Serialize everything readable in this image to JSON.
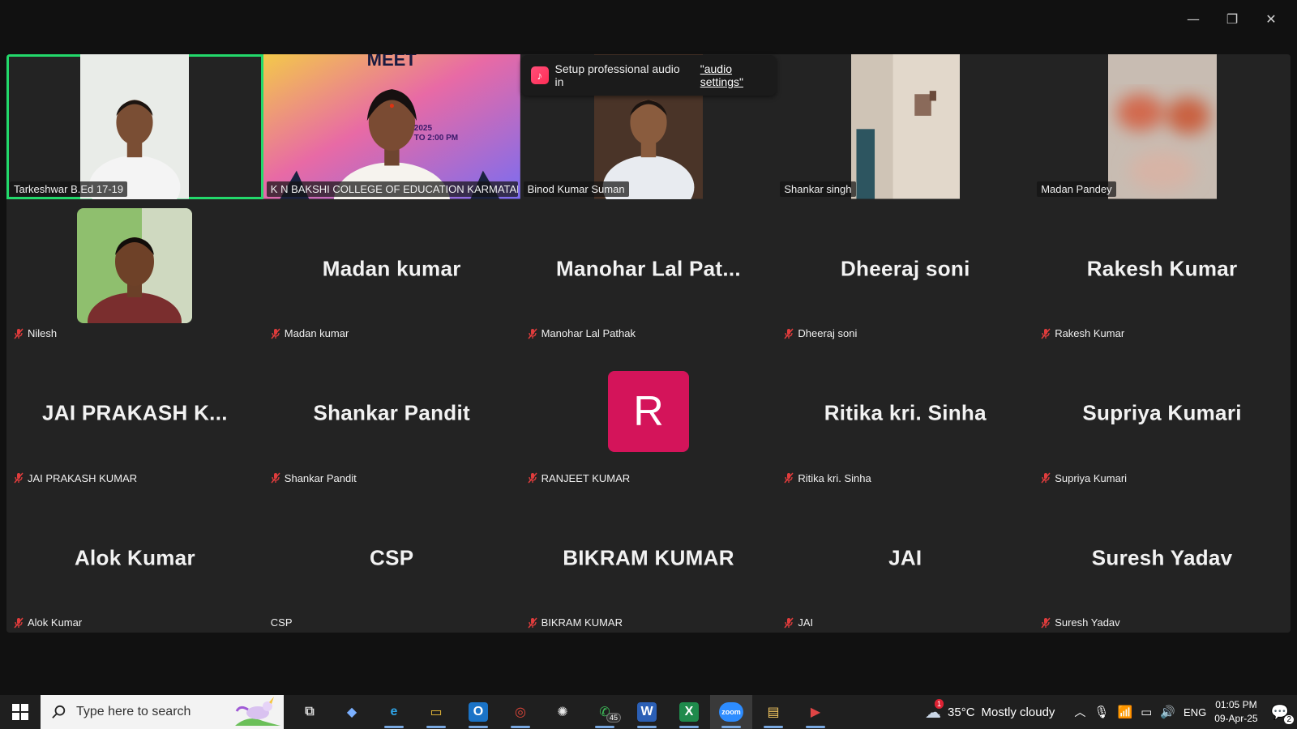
{
  "window": {
    "controls": [
      "—",
      "❐",
      "✕"
    ]
  },
  "toast": {
    "text": "Setup professional audio in",
    "link": "\"audio settings\""
  },
  "tiles": [
    {
      "kind": "video",
      "plate": "Tarkeshwar B.Ed 17-19",
      "muted": false,
      "active": true
    },
    {
      "kind": "video-wide",
      "plate": "K N BAKSHI COLLEGE OF EDUCATION KARMATAND...",
      "muted": false,
      "banner": "MEET",
      "banner_time": "2025",
      "banner_time2": "TO 2:00 PM"
    },
    {
      "kind": "video",
      "plate": "Binod Kumar Suman",
      "muted": false
    },
    {
      "kind": "video",
      "plate": "Shankar singh",
      "muted": false
    },
    {
      "kind": "video",
      "plate": "Madan Pandey",
      "muted": false
    },
    {
      "kind": "photo",
      "plate": "Nilesh",
      "muted": true
    },
    {
      "kind": "name",
      "big": "Madan kumar",
      "plate": "Madan kumar",
      "muted": true
    },
    {
      "kind": "name",
      "big": "Manohar  Lal  Pat...",
      "plate": "Manohar Lal Pathak",
      "muted": true
    },
    {
      "kind": "name",
      "big": "Dheeraj soni",
      "plate": "Dheeraj soni",
      "muted": true
    },
    {
      "kind": "name",
      "big": "Rakesh Kumar",
      "plate": "Rakesh Kumar",
      "muted": true
    },
    {
      "kind": "name",
      "big": "JAI  PRAKASH  K...",
      "plate": "JAI PRAKASH KUMAR",
      "muted": true
    },
    {
      "kind": "name",
      "big": "Shankar Pandit",
      "plate": "Shankar Pandit",
      "muted": true
    },
    {
      "kind": "letter",
      "letter": "R",
      "plate": "RANJEET KUMAR",
      "muted": true
    },
    {
      "kind": "name",
      "big": "Ritika kri. Sinha",
      "plate": "Ritika kri. Sinha",
      "muted": true
    },
    {
      "kind": "name",
      "big": "Supriya Kumari",
      "plate": "Supriya Kumari",
      "muted": true
    },
    {
      "kind": "name",
      "big": "Alok Kumar",
      "plate": "Alok Kumar",
      "muted": true
    },
    {
      "kind": "name",
      "big": "CSP",
      "plate": "CSP",
      "muted": false
    },
    {
      "kind": "name",
      "big": "BIKRAM KUMAR",
      "plate": "BIKRAM KUMAR",
      "muted": true
    },
    {
      "kind": "name",
      "big": "JAI",
      "plate": "JAI",
      "muted": true
    },
    {
      "kind": "name",
      "big": "Suresh Yadav",
      "plate": "Suresh Yadav",
      "muted": true
    }
  ],
  "taskbar": {
    "search_placeholder": "Type here to search",
    "apps": [
      {
        "name": "task-view",
        "glyph": "⧉"
      },
      {
        "name": "copilot",
        "glyph": "◆"
      },
      {
        "name": "edge",
        "glyph": "e"
      },
      {
        "name": "file-explorer",
        "glyph": "▭"
      },
      {
        "name": "outlook",
        "glyph": "O"
      },
      {
        "name": "chrome",
        "glyph": "◎"
      },
      {
        "name": "chatgpt",
        "glyph": "✺"
      },
      {
        "name": "whatsapp",
        "glyph": "✆",
        "badge": "45"
      },
      {
        "name": "word",
        "glyph": "W"
      },
      {
        "name": "excel",
        "glyph": "X"
      },
      {
        "name": "zoom",
        "glyph": "zoom"
      },
      {
        "name": "folder",
        "glyph": "▤"
      },
      {
        "name": "media-player",
        "glyph": "▶"
      }
    ],
    "weather": {
      "temp": "35°C",
      "desc": "Mostly cloudy",
      "alert": "1"
    },
    "lang": "ENG",
    "time": "01:05 PM",
    "date": "09-Apr-25",
    "notif_count": "2"
  }
}
